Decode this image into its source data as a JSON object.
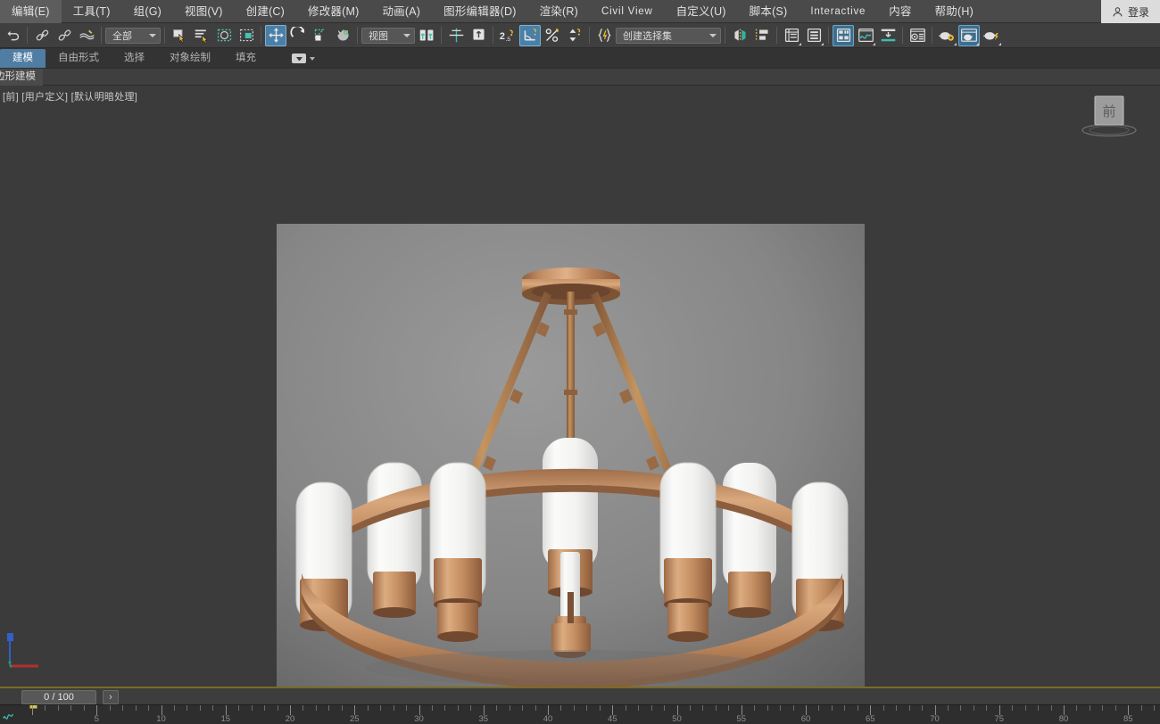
{
  "app": {
    "title": "3ds Max",
    "bg": "#3b3b3b",
    "accent": "#4f7da3"
  },
  "menubar": {
    "items": [
      {
        "label": "编辑(E)",
        "name": "menu-edit",
        "latin": false
      },
      {
        "label": "工具(T)",
        "name": "menu-tools",
        "latin": false
      },
      {
        "label": "组(G)",
        "name": "menu-group",
        "latin": false
      },
      {
        "label": "视图(V)",
        "name": "menu-views",
        "latin": false
      },
      {
        "label": "创建(C)",
        "name": "menu-create",
        "latin": false
      },
      {
        "label": "修改器(M)",
        "name": "menu-modifiers",
        "latin": false
      },
      {
        "label": "动画(A)",
        "name": "menu-animation",
        "latin": false
      },
      {
        "label": "图形编辑器(D)",
        "name": "menu-graph-editors",
        "latin": false
      },
      {
        "label": "渲染(R)",
        "name": "menu-rendering",
        "latin": false
      },
      {
        "label": "Civil View",
        "name": "menu-civil-view",
        "latin": true
      },
      {
        "label": "自定义(U)",
        "name": "menu-customize",
        "latin": false
      },
      {
        "label": "脚本(S)",
        "name": "menu-scripting",
        "latin": false
      },
      {
        "label": "Interactive",
        "name": "menu-interactive",
        "latin": true
      },
      {
        "label": "内容",
        "name": "menu-content",
        "latin": false
      },
      {
        "label": "帮助(H)",
        "name": "menu-help",
        "latin": false
      }
    ],
    "signin_label": "登录"
  },
  "toolbar": {
    "selection_filter": {
      "value": "全部",
      "name": "selection-filter-combo"
    },
    "reference_coord": {
      "value": "视图",
      "name": "reference-coordinate-system-combo"
    },
    "named_selection_set": {
      "value": "创建选择集",
      "name": "named-selection-set-combo"
    },
    "percent_snap": "",
    "buttons": [
      {
        "name": "undo-button",
        "icon": "undo-arrow"
      },
      {
        "name": "select-and-link-button",
        "icon": "link"
      },
      {
        "name": "unlink-selection-button",
        "icon": "unlink"
      },
      {
        "name": "bind-to-space-warp-button",
        "icon": "space-warp"
      },
      {
        "name": "select-object-button",
        "icon": "select-arrow"
      },
      {
        "name": "select-by-name-button",
        "icon": "select-by-name"
      },
      {
        "name": "rectangular-selection-region-button",
        "icon": "marquee-region"
      },
      {
        "name": "window-crossing-button",
        "icon": "window-crossing"
      },
      {
        "name": "select-and-move-button",
        "icon": "move-gizmo",
        "active": true
      },
      {
        "name": "select-and-rotate-button",
        "icon": "rotate-gizmo"
      },
      {
        "name": "select-and-scale-button",
        "icon": "scale-gizmo"
      },
      {
        "name": "select-and-place-button",
        "icon": "place-object"
      },
      {
        "name": "use-center-button",
        "icon": "use-pivot-center"
      },
      {
        "name": "mirror-button",
        "icon": "mirror-axis"
      },
      {
        "name": "align-button",
        "icon": "align"
      },
      {
        "name": "snaps-toggle-button",
        "icon": "snap-2-5d"
      },
      {
        "name": "angle-snap-toggle-button",
        "icon": "angle-snap",
        "active": true
      },
      {
        "name": "percent-snap-toggle-button",
        "icon": "percent-snap"
      },
      {
        "name": "spinner-snap-toggle-button",
        "icon": "spinner-snap"
      },
      {
        "name": "edit-named-selection-sets-button",
        "icon": "named-sets-braces"
      },
      {
        "name": "mirror-tool-button",
        "icon": "mirror-geometry"
      },
      {
        "name": "align-tool-button",
        "icon": "align-tool"
      },
      {
        "name": "layer-explorer-button",
        "icon": "layers-panel"
      },
      {
        "name": "scene-explorer-button",
        "icon": "scene-explorer"
      },
      {
        "name": "toggle-ribbon-button",
        "icon": "ribbon-toggle"
      },
      {
        "name": "curve-editor-button",
        "icon": "curve-editor",
        "active": true
      },
      {
        "name": "schematic-view-button",
        "icon": "schematic-view"
      },
      {
        "name": "compact-material-editor-button",
        "icon": "material-editor-compact"
      },
      {
        "name": "material-editor-button",
        "icon": "material-editor-slate"
      },
      {
        "name": "render-setup-button",
        "icon": "render-setup-teapot-gear"
      },
      {
        "name": "rendered-frame-window-button",
        "icon": "rendered-frame-window",
        "on": true
      },
      {
        "name": "render-production-button",
        "icon": "render-production-teapot"
      }
    ]
  },
  "ribbon": {
    "tabs": [
      {
        "label": "建模",
        "name": "ribbon-tab-modeling",
        "selected": true
      },
      {
        "label": "自由形式",
        "name": "ribbon-tab-freeform",
        "selected": false
      },
      {
        "label": "选择",
        "name": "ribbon-tab-selection",
        "selected": false
      },
      {
        "label": "对象绘制",
        "name": "ribbon-tab-object-paint",
        "selected": false
      },
      {
        "label": "填充",
        "name": "ribbon-tab-populate",
        "selected": false
      }
    ],
    "panel_label": "边形建模"
  },
  "viewport": {
    "label_parts": [
      "[前]",
      "[用户定义]",
      "[默认明暗处理]"
    ],
    "viewcube_face": "前",
    "render": {
      "description": "红铜色吸顶式圆环吊灯渲染图",
      "bg_top": "#8c8c8c",
      "bg_bottom": "#6b6b6b",
      "metal_light": "#d9a277",
      "metal_mid": "#b87d52",
      "metal_dark": "#8a5a38",
      "shade_color": "#f2f2f0",
      "shade_count": 8
    }
  },
  "timeslider": {
    "current": "0",
    "total": "100",
    "display": "0 / 100",
    "next_label": "›"
  },
  "ruler": {
    "labels": [
      "5",
      "10",
      "15",
      "20",
      "25",
      "30",
      "35",
      "40",
      "45",
      "50",
      "55",
      "60",
      "65",
      "70",
      "75",
      "80",
      "85"
    ],
    "start": 0,
    "end": 88,
    "major_step": 5
  }
}
